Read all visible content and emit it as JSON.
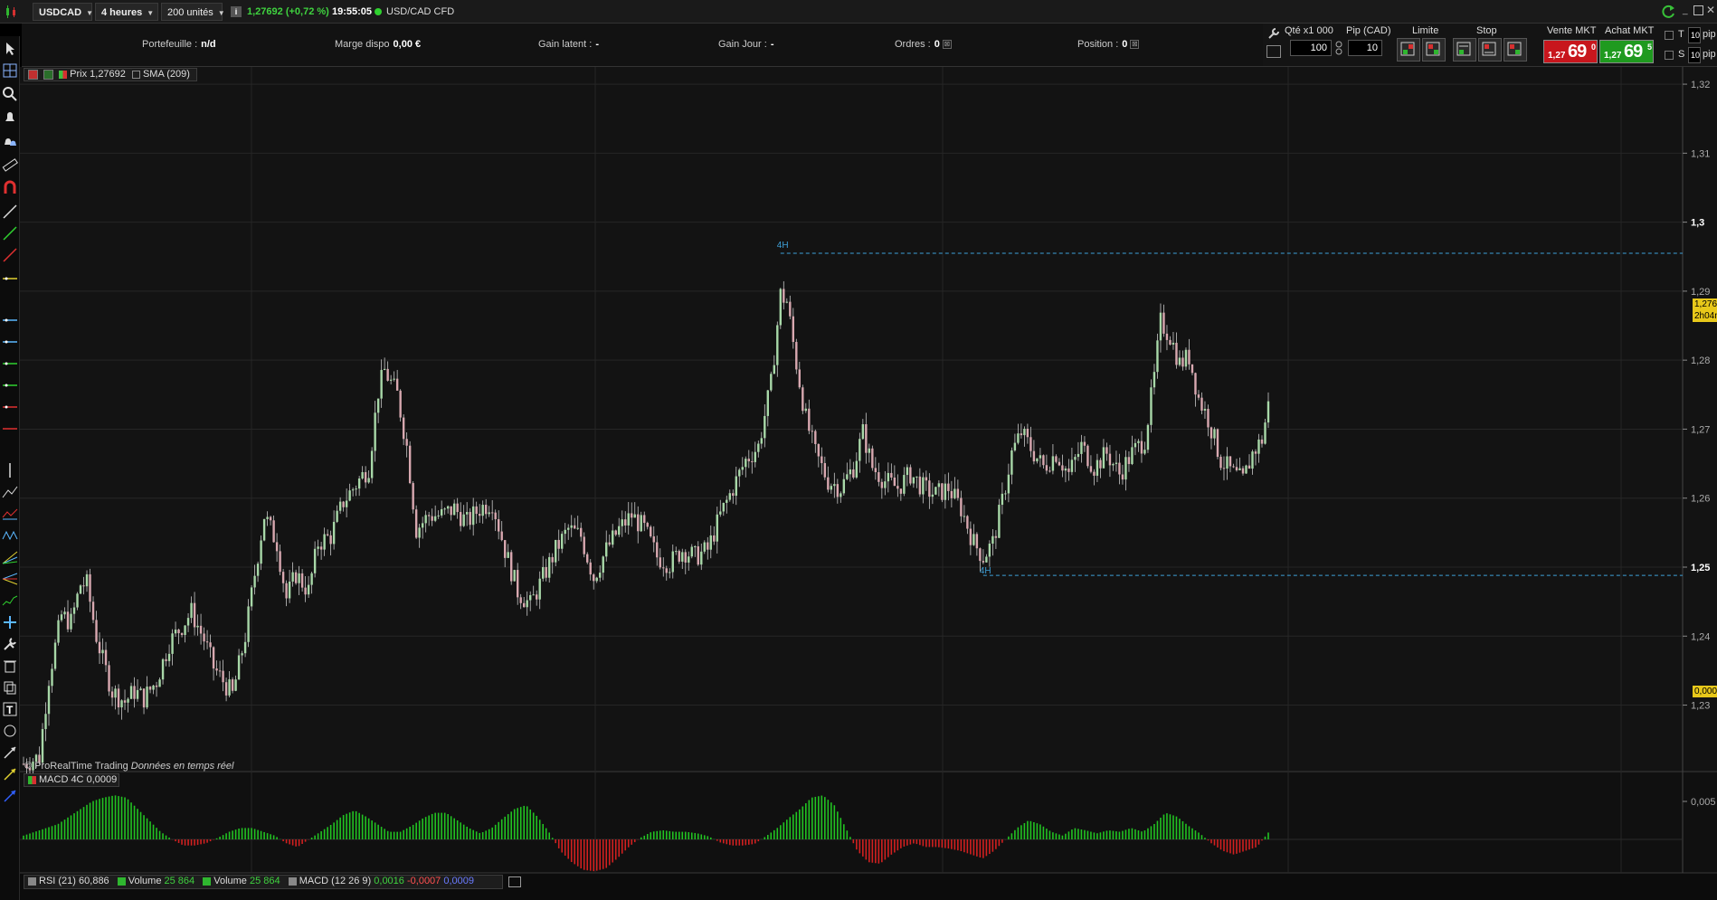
{
  "topbar": {
    "symbol": "USDCAD",
    "timeframe": "4 heures",
    "units": "200 unités",
    "price_change": "1,27692 (+0,72 %)",
    "time": "19:55:05",
    "instrument": "USD/CAD CFD"
  },
  "infobar": {
    "portfolio_label": "Portefeuille :",
    "portfolio_value": "n/d",
    "margin_label": "Marge dispo",
    "margin_value": "0,00 €",
    "latent_label": "Gain latent :",
    "latent_value": "-",
    "day_label": "Gain Jour :",
    "day_value": "-",
    "orders_label": "Ordres :",
    "orders_value": "0",
    "position_label": "Position :",
    "position_value": "0"
  },
  "order_panel": {
    "qty_label": "Qté x1 000",
    "qty_value": "100",
    "pip_label": "Pip (CAD)",
    "pip_value": "10",
    "limit_label": "Limite",
    "stop_label": "Stop",
    "sell_label": "Vente MKT",
    "buy_label": "Achat MKT",
    "sell_small": "1,27",
    "sell_big": "69",
    "sell_sup": "0",
    "buy_small": "1,27",
    "buy_big": "69",
    "buy_sup": "5",
    "opt_t": "T",
    "opt_s": "S",
    "opt_unit1": "pip",
    "opt_unit2": "pip",
    "opt_val1": "10",
    "opt_val2": "10",
    "colors": {
      "sell": "#c8161d",
      "buy": "#1f9a1f"
    }
  },
  "legend": {
    "price_label": "Prix",
    "price_value": "1,27692",
    "sma_label": "SMA (209)",
    "macd_label": "MACD 4C",
    "macd_value": "0,0009"
  },
  "bottom_legend": {
    "rsi": "RSI (21)",
    "rsi_value": "60,886",
    "vol1": "Volume",
    "vol1_value": "25 864",
    "vol2": "Volume",
    "vol2_value": "25 864",
    "macd": "MACD (12 26 9)",
    "macd_v1": "0,0016",
    "macd_v2": "-0,0007",
    "macd_v3": "0,0009"
  },
  "credit": {
    "brand": "© ProRealTime Trading",
    "realtime": "Données en temps réel"
  },
  "chart_data": {
    "type": "candlestick",
    "y_ticks": [
      "1,32",
      "1,31",
      "1,3",
      "1,29",
      "1,28",
      "1,27",
      "1,26",
      "1,25",
      "1,24",
      "1,23"
    ],
    "y_range": [
      1.2205,
      1.3225
    ],
    "macd_ticks": [
      "0,005",
      "0,000"
    ],
    "last_price_label": "1,276",
    "countdown_label": "2h04m",
    "marker_high_label": "4H",
    "marker_low_label": "4H",
    "marker_high_value": 1.2955,
    "marker_low_value": 1.2488,
    "series_path": [
      [
        0,
        1.2215
      ],
      [
        5,
        1.2225
      ],
      [
        8,
        1.234
      ],
      [
        12,
        1.243
      ],
      [
        15,
        1.242
      ],
      [
        18,
        1.2475
      ],
      [
        20,
        1.2475
      ],
      [
        23,
        1.24
      ],
      [
        25,
        1.2365
      ],
      [
        28,
        1.232
      ],
      [
        32,
        1.2305
      ],
      [
        35,
        1.232
      ],
      [
        38,
        1.231
      ],
      [
        42,
        1.2335
      ],
      [
        46,
        1.239
      ],
      [
        50,
        1.2415
      ],
      [
        53,
        1.2435
      ],
      [
        57,
        1.2395
      ],
      [
        60,
        1.2355
      ],
      [
        63,
        1.2335
      ],
      [
        66,
        1.2315
      ],
      [
        70,
        1.24
      ],
      [
        73,
        1.249
      ],
      [
        76,
        1.2575
      ],
      [
        80,
        1.2535
      ],
      [
        83,
        1.2455
      ],
      [
        86,
        1.249
      ],
      [
        90,
        1.2465
      ],
      [
        93,
        1.2535
      ],
      [
        97,
        1.2545
      ],
      [
        101,
        1.2595
      ],
      [
        105,
        1.262
      ],
      [
        109,
        1.2645
      ],
      [
        112,
        1.2755
      ],
      [
        114,
        1.2785
      ],
      [
        118,
        1.275
      ],
      [
        121,
        1.2675
      ],
      [
        124,
        1.2555
      ],
      [
        128,
        1.2575
      ],
      [
        132,
        1.2575
      ],
      [
        136,
        1.2585
      ],
      [
        140,
        1.2565
      ],
      [
        144,
        1.2585
      ],
      [
        148,
        1.2595
      ],
      [
        152,
        1.2525
      ],
      [
        156,
        1.2465
      ],
      [
        160,
        1.2445
      ],
      [
        164,
        1.2485
      ],
      [
        168,
        1.2525
      ],
      [
        172,
        1.2555
      ],
      [
        176,
        1.2545
      ],
      [
        180,
        1.2485
      ],
      [
        184,
        1.2525
      ],
      [
        188,
        1.2555
      ],
      [
        192,
        1.2575
      ],
      [
        196,
        1.2555
      ],
      [
        200,
        1.2515
      ],
      [
        204,
        1.2505
      ],
      [
        208,
        1.2525
      ],
      [
        212,
        1.2515
      ],
      [
        216,
        1.2525
      ],
      [
        220,
        1.2575
      ],
      [
        224,
        1.2615
      ],
      [
        228,
        1.2655
      ],
      [
        232,
        1.2675
      ],
      [
        236,
        1.2765
      ],
      [
        239,
        1.2895
      ],
      [
        241,
        1.2885
      ],
      [
        244,
        1.2795
      ],
      [
        247,
        1.2715
      ],
      [
        250,
        1.2665
      ],
      [
        254,
        1.2625
      ],
      [
        258,
        1.2615
      ],
      [
        262,
        1.2645
      ],
      [
        265,
        1.2695
      ],
      [
        268,
        1.2645
      ],
      [
        272,
        1.2625
      ],
      [
        276,
        1.2615
      ],
      [
        280,
        1.2635
      ],
      [
        284,
        1.2615
      ],
      [
        288,
        1.2605
      ],
      [
        292,
        1.2615
      ],
      [
        296,
        1.2585
      ],
      [
        300,
        1.2535
      ],
      [
        303,
        1.2515
      ],
      [
        306,
        1.2535
      ],
      [
        309,
        1.2595
      ],
      [
        312,
        1.2665
      ],
      [
        315,
        1.2695
      ],
      [
        319,
        1.2665
      ],
      [
        322,
        1.2645
      ],
      [
        326,
        1.2665
      ],
      [
        330,
        1.2635
      ],
      [
        334,
        1.2675
      ],
      [
        338,
        1.2645
      ],
      [
        342,
        1.2665
      ],
      [
        346,
        1.2635
      ],
      [
        350,
        1.2665
      ],
      [
        354,
        1.2685
      ],
      [
        357,
        1.2775
      ],
      [
        359,
        1.2855
      ],
      [
        362,
        1.2835
      ],
      [
        365,
        1.2795
      ],
      [
        368,
        1.2805
      ],
      [
        371,
        1.2745
      ],
      [
        374,
        1.2715
      ],
      [
        378,
        1.2655
      ],
      [
        382,
        1.2635
      ],
      [
        385,
        1.2625
      ],
      [
        388,
        1.2665
      ],
      [
        391,
        1.2685
      ],
      [
        393,
        1.2735
      ]
    ],
    "macd": [
      0.0005,
      0.001,
      0.0015,
      0.002,
      0.003,
      0.004,
      0.005,
      0.0055,
      0.0058,
      0.0055,
      0.004,
      0.0025,
      0.001,
      0.0,
      -0.0008,
      -0.0008,
      -0.0005,
      0.0002,
      0.001,
      0.0015,
      0.0015,
      0.001,
      0.0005,
      -0.0005,
      -0.001,
      0.0,
      0.001,
      0.002,
      0.0032,
      0.0038,
      0.003,
      0.002,
      0.001,
      0.001,
      0.0018,
      0.0028,
      0.0035,
      0.0035,
      0.0025,
      0.0015,
      0.0008,
      0.0015,
      0.0028,
      0.004,
      0.0045,
      0.003,
      0.001,
      -0.0015,
      -0.003,
      -0.004,
      -0.0042,
      -0.0038,
      -0.0025,
      -0.001,
      0.0002,
      0.001,
      0.0012,
      0.001,
      0.001,
      0.0008,
      0.0004,
      -0.0004,
      -0.0008,
      -0.0008,
      -0.0006,
      0.0004,
      0.0015,
      0.0028,
      0.004,
      0.0055,
      0.0058,
      0.0045,
      0.0015,
      -0.0015,
      -0.003,
      -0.0032,
      -0.002,
      -0.001,
      -0.0005,
      -0.001,
      -0.001,
      -0.0012,
      -0.0015,
      -0.002,
      -0.0025,
      -0.0015,
      0.0,
      0.0015,
      0.0025,
      0.002,
      0.001,
      0.0005,
      0.0015,
      0.0012,
      0.0008,
      0.0012,
      0.001,
      0.0015,
      0.001,
      0.002,
      0.0035,
      0.003,
      0.0018,
      0.0008,
      -0.0005,
      -0.0015,
      -0.002,
      -0.0015,
      -0.001,
      0.0009
    ]
  }
}
